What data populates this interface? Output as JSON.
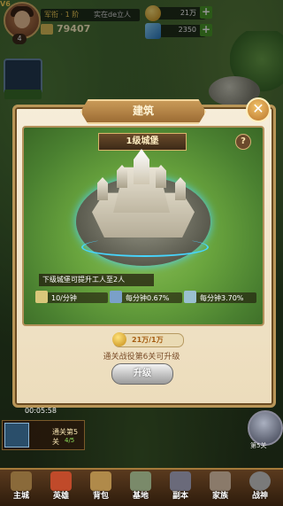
{
  "hud": {
    "vip_label": "V6",
    "avatar_level": "4",
    "rank_label": "军衔 · 1 阶",
    "player_name": "实在de立人",
    "power_value": "79407",
    "gold_value": "21万",
    "gem_value": "2350"
  },
  "dialog": {
    "title": "建筑",
    "building_level": "1级城堡",
    "help_label": "?",
    "description": "下级城堡可提升工人至2人",
    "stats": [
      {
        "icon": "scroll-icon",
        "value": "10/分钟",
        "color": "#d9c77a"
      },
      {
        "icon": "sword-icon",
        "value": "每分钟0.67%",
        "color": "#7aa0c8"
      },
      {
        "icon": "crate-icon",
        "value": "每分钟3.70%",
        "color": "#9ac0d0"
      }
    ],
    "cost_value": "21万/1万",
    "unlock_requirement": "通关战役第6关可升级",
    "upgrade_label": "升级"
  },
  "bottom": {
    "timer": "00:05:58",
    "task_title": "通关第5关",
    "task_progress": "4/5",
    "boss_label": "第5关",
    "nav": [
      {
        "label": "主城",
        "icon": "castle-icon",
        "color": "#8a6a3a"
      },
      {
        "label": "英雄",
        "icon": "hero-icon",
        "color": "#c04a2a"
      },
      {
        "label": "背包",
        "icon": "bag-icon",
        "color": "#b08a4a"
      },
      {
        "label": "基地",
        "icon": "base-icon",
        "color": "#7a8a6a"
      },
      {
        "label": "副本",
        "icon": "dungeon-icon",
        "color": "#6a6a7a"
      },
      {
        "label": "家族",
        "icon": "family-icon",
        "color": "#8a7a6a"
      },
      {
        "label": "战神",
        "icon": "wargod-icon",
        "color": "#7a7a7a"
      }
    ]
  },
  "colors": {
    "dialog_bg": "#f2e6cc",
    "accent_gold": "#c99a58",
    "moat_glow": "#46d6ff"
  }
}
